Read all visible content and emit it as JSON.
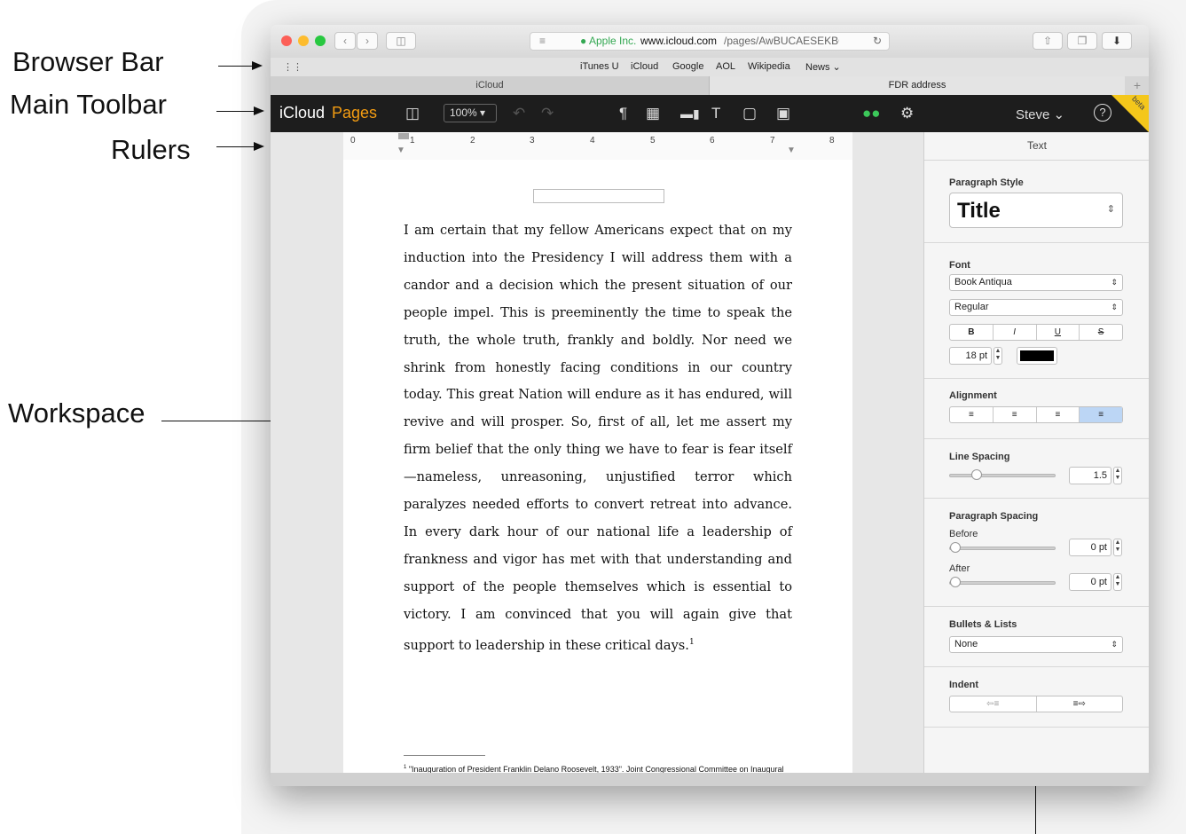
{
  "annotations": {
    "browser_bar": "Browser Bar",
    "main_toolbar": "Main Toolbar",
    "rulers": "Rulers",
    "workspace": "Workspace"
  },
  "browser": {
    "url_owner": "Apple Inc.",
    "url_host": "www.icloud.com",
    "url_path": "/pages/AwBUCAESEKBC",
    "favorites": [
      "iTunes U",
      "iCloud",
      "Google",
      "AOL",
      "Wikipedia",
      "News ⌄"
    ],
    "tabs": [
      "iCloud",
      "FDR address"
    ],
    "new_tab": "+"
  },
  "toolbar": {
    "brand_icloud": "iCloud",
    "brand_app": "Pages",
    "zoom": "100% ▾",
    "user": "Steve ⌄",
    "help": "?",
    "beta": "beta"
  },
  "ruler": {
    "numbers": [
      "0",
      "1",
      "2",
      "3",
      "4",
      "5",
      "6",
      "7",
      "8"
    ]
  },
  "document": {
    "body": "I am certain that my fellow Americans expect that on my induction into the Presidency I will address them with a candor and a decision which the present situation of our people impel. This is preeminently the time to speak the truth, the whole truth, frankly and boldly. Nor need we shrink from honestly facing conditions in our country today. This great Nation will endure as it has endured, will revive and will prosper. So, first of all, let me assert my firm belief that the only thing we have to fear is fear itself —nameless, unreasoning, unjustified terror which paralyzes needed efforts to convert retreat into advance. In every dark hour of our national life a leadership of frankness and vigor has met with that understanding and support of the people themselves which is essential to victory. I am convinced that you will again give that support to leadership in these critical days.",
    "footnote_ref": "1",
    "footnote": "\"Inauguration of President Franklin Delano Roosevelt, 1933\". Joint Congressional Committee on Inaugural Ceremonies."
  },
  "sidebar": {
    "header": "Text",
    "paragraph_style_label": "Paragraph Style",
    "paragraph_style": "Title",
    "font_label": "Font",
    "font_family": "Book Antiqua",
    "font_weight": "Regular",
    "bold": "B",
    "italic": "I",
    "underline": "U",
    "strike": "S",
    "font_size": "18 pt",
    "font_color": "#000000",
    "alignment_label": "Alignment",
    "alignment_active": "justify",
    "line_spacing_label": "Line Spacing",
    "line_spacing": "1.5",
    "paragraph_spacing_label": "Paragraph Spacing",
    "before_label": "Before",
    "before_value": "0 pt",
    "after_label": "After",
    "after_value": "0 pt",
    "bullets_label": "Bullets & Lists",
    "bullets_value": "None",
    "indent_label": "Indent"
  },
  "colors": {
    "toolbar_bg": "#1d1d1d",
    "brand_accent": "#f39c12",
    "collab_icon": "#3cc85a",
    "active_segment": "#bcd6f5",
    "url_lock": "#34a853"
  }
}
